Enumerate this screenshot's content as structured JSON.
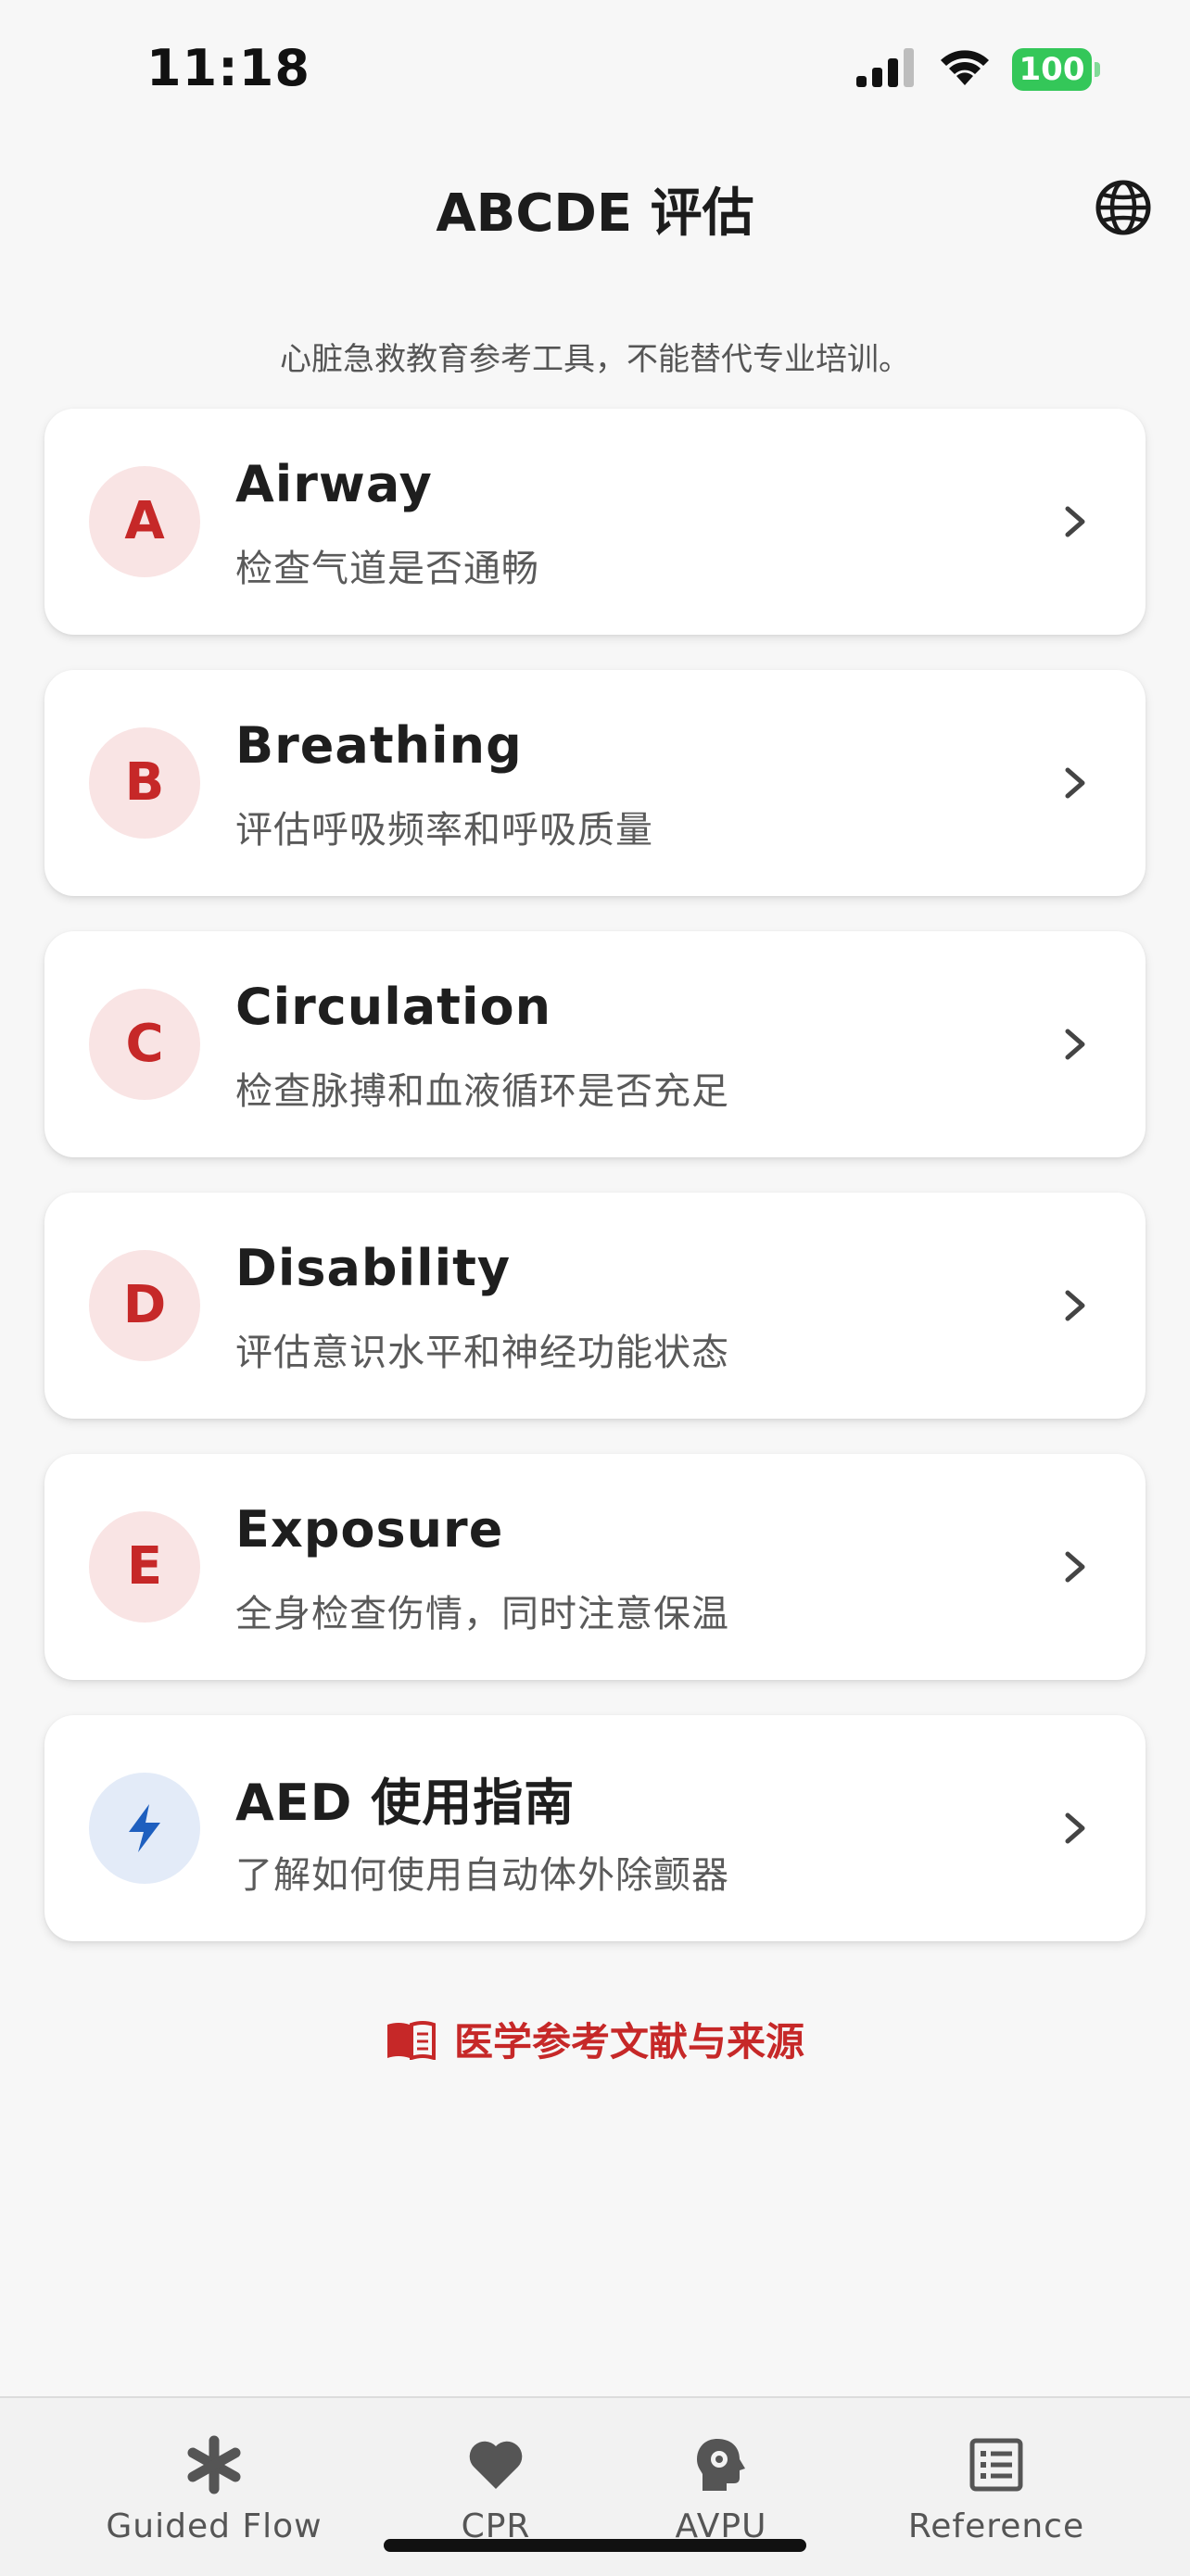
{
  "status_bar": {
    "time": "11:18",
    "battery": "100",
    "battery_color": "#34c759"
  },
  "header": {
    "title": "ABCDE 评估",
    "globe_icon": "globe-icon"
  },
  "disclaimer": "心脏急救教育参考工具，不能替代专业培训。",
  "cards": [
    {
      "badge": "A",
      "title": "Airway",
      "subtitle": "检查气道是否通畅"
    },
    {
      "badge": "B",
      "title": "Breathing",
      "subtitle": "评估呼吸频率和呼吸质量"
    },
    {
      "badge": "C",
      "title": "Circulation",
      "subtitle": "检查脉搏和血液循环是否充足"
    },
    {
      "badge": "D",
      "title": "Disability",
      "subtitle": "评估意识水平和神经功能状态"
    },
    {
      "badge": "E",
      "title": "Exposure",
      "subtitle": "全身检查伤情，同时注意保温"
    },
    {
      "badge_icon": "lightning-icon",
      "title": "AED 使用指南",
      "subtitle": "了解如何使用自动体外除颤器"
    }
  ],
  "reference_link": {
    "label": "医学参考文献与来源",
    "icon": "book-icon",
    "color": "#c62828"
  },
  "tabs": [
    {
      "label": "Guided Flow",
      "icon": "asterisk-icon"
    },
    {
      "label": "CPR",
      "icon": "heart-icon"
    },
    {
      "label": "AVPU",
      "icon": "head-gear-icon"
    },
    {
      "label": "Reference",
      "icon": "list-icon"
    }
  ],
  "colors": {
    "accent_red": "#c62828",
    "badge_bg": "#f9e4e4",
    "aed_badge_bg": "#e3ebf8",
    "aed_icon": "#1e5fbf",
    "background": "#f7f7f7"
  }
}
